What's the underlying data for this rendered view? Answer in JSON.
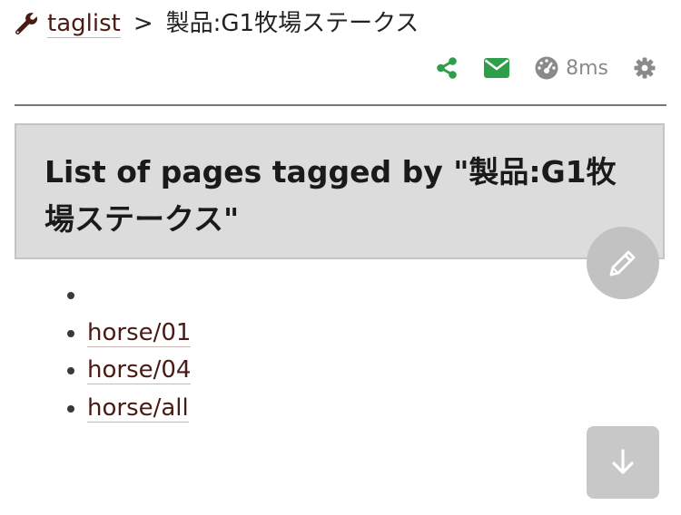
{
  "breadcrumb": {
    "wrench_icon": "wrench-icon",
    "root_label": "taglist",
    "separator": ">",
    "current": "製品:G1牧場ステークス"
  },
  "toolbar": {
    "share_icon": "share-icon",
    "mail_icon": "envelope-icon",
    "timer_icon": "dashboard-icon",
    "timer_text": "8ms",
    "settings_icon": "gear-icon",
    "colors": {
      "share": "#2e9e4a",
      "mail": "#2e9e4a",
      "muted": "#8a8a8a"
    }
  },
  "title": {
    "text": "List of pages tagged by \"製品:G1牧場ステークス\""
  },
  "tag_list": {
    "items": [
      {
        "label": ""
      },
      {
        "label": "horse/01"
      },
      {
        "label": "horse/04"
      },
      {
        "label": "horse/all"
      }
    ]
  },
  "edit_button": {
    "icon": "pencil-icon"
  },
  "scroll_down_button": {
    "icon": "arrow-down-icon"
  },
  "colors": {
    "link": "#4a1a14",
    "title_bg": "#dcdcdc",
    "fab": "#c2c2c2"
  }
}
